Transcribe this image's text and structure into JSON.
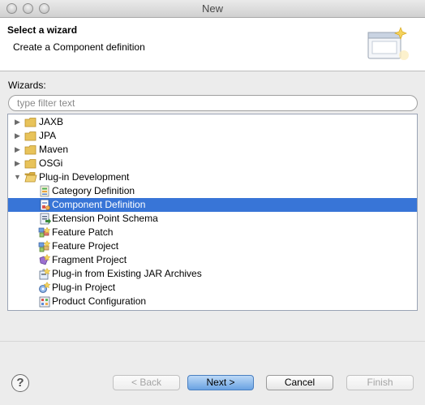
{
  "window": {
    "title": "New"
  },
  "header": {
    "title": "Select a wizard",
    "description": "Create a Component definition"
  },
  "wizards_label": "Wizards:",
  "filter": {
    "placeholder": "type filter text",
    "value": ""
  },
  "tree": {
    "items": [
      {
        "label": "JAXB",
        "type": "folder",
        "expanded": false,
        "selected": false
      },
      {
        "label": "JPA",
        "type": "folder",
        "expanded": false,
        "selected": false
      },
      {
        "label": "Maven",
        "type": "folder",
        "expanded": false,
        "selected": false
      },
      {
        "label": "OSGi",
        "type": "folder",
        "expanded": false,
        "selected": false
      },
      {
        "label": "Plug-in Development",
        "type": "folder",
        "expanded": true,
        "selected": false
      },
      {
        "label": "Category Definition",
        "type": "wizard",
        "icon": "category-definition-icon",
        "selected": false
      },
      {
        "label": "Component Definition",
        "type": "wizard",
        "icon": "component-definition-icon",
        "selected": true
      },
      {
        "label": "Extension Point Schema",
        "type": "wizard",
        "icon": "extension-point-schema-icon",
        "selected": false
      },
      {
        "label": "Feature Patch",
        "type": "wizard",
        "icon": "feature-patch-icon",
        "selected": false
      },
      {
        "label": "Feature Project",
        "type": "wizard",
        "icon": "feature-project-icon",
        "selected": false
      },
      {
        "label": "Fragment Project",
        "type": "wizard",
        "icon": "fragment-project-icon",
        "selected": false
      },
      {
        "label": "Plug-in from Existing JAR Archives",
        "type": "wizard",
        "icon": "plugin-from-jar-icon",
        "selected": false
      },
      {
        "label": "Plug-in Project",
        "type": "wizard",
        "icon": "plugin-project-icon",
        "selected": false
      },
      {
        "label": "Product Configuration",
        "type": "wizard",
        "icon": "product-configuration-icon",
        "selected": false
      }
    ]
  },
  "buttons": {
    "help": "?",
    "back": "< Back",
    "next": "Next >",
    "cancel": "Cancel",
    "finish": "Finish"
  },
  "colors": {
    "selection": "#3875d7",
    "folder": "#e8c35a"
  }
}
